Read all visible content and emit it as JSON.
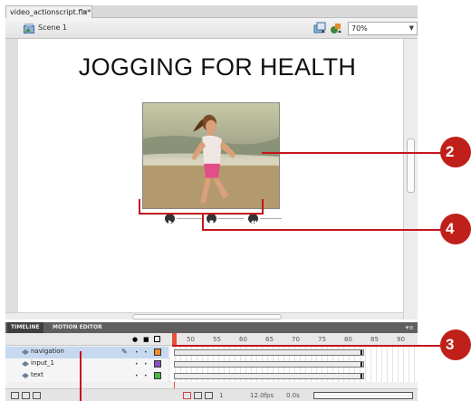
{
  "document_tab": {
    "label": "video_actionscript.fla*",
    "close": "×"
  },
  "scene_bar": {
    "scene_label": "Scene 1",
    "zoom_value": "70%"
  },
  "stage": {
    "title": "JOGGING FOR HEALTH"
  },
  "panel_tabs": [
    {
      "label": "TIMELINE",
      "active": true
    },
    {
      "label": "MOTION EDITOR",
      "active": false
    }
  ],
  "timeline": {
    "frame_numbers": [
      "50",
      "55",
      "60",
      "65",
      "70",
      "75",
      "80",
      "85",
      "90"
    ],
    "layers": [
      {
        "name": "navigation",
        "selected": true,
        "color": "#f08c2a"
      },
      {
        "name": "input_1",
        "selected": false,
        "color": "#8a4fc6"
      },
      {
        "name": "text",
        "selected": false,
        "color": "#49b848"
      }
    ],
    "footer": {
      "current_frame": "1",
      "fps": "12.0fps",
      "elapsed": "0.0s"
    }
  },
  "callouts": [
    "2",
    "4",
    "3"
  ],
  "colors": {
    "callout_red": "#c0201a",
    "playhead": "#e8523b",
    "selected_layer": "#c6d9f1"
  }
}
